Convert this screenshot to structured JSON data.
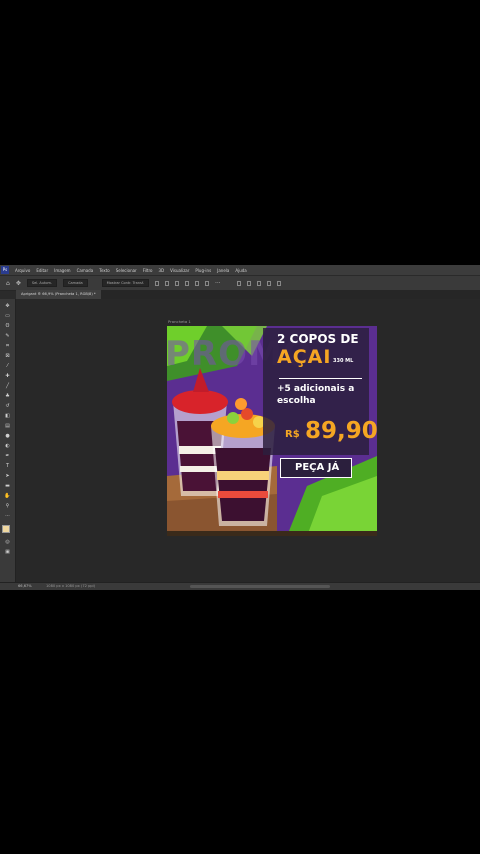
{
  "menubar": {
    "items": [
      "Arquivo",
      "Editar",
      "Imagem",
      "Camada",
      "Texto",
      "Selecionar",
      "Filtro",
      "3D",
      "Visualizar",
      "Plug-ins",
      "Janela",
      "Ajuda"
    ]
  },
  "options_bar": {
    "field_1": "Sel. Autom.",
    "field_2": "Camada",
    "field_3": "Mostrar Contr. Transf."
  },
  "document": {
    "tab_title": "Aprigant ® 66,9% (Prancheta 1, RGB/8) *",
    "artboard_label": "Prancheta 1"
  },
  "status": {
    "zoom": "66,67%",
    "doc_info": "1080 px x 1080 px (72 ppi)"
  },
  "ad": {
    "headline_line1": "2 COPOS DE",
    "headline_line2": "AÇAI",
    "size": "330 ML",
    "extras_line1": "+5 adicionais a",
    "extras_line2": "escolha",
    "currency": "R$",
    "price": "89,90",
    "cta": "PEÇA JÁ",
    "background_word": "PROMO"
  },
  "colors": {
    "accent_orange": "#f5a623",
    "brand_purple": "#5b2e91",
    "dark_panel": "#2b1f3d",
    "grass_green": "#6fcf2b"
  }
}
